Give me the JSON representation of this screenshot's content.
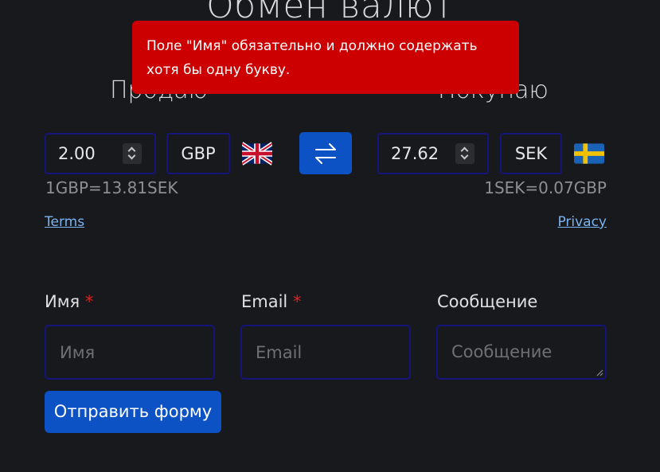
{
  "page": {
    "title": "Обмен валют"
  },
  "toast": {
    "message": "Поле \"Имя\" обязательно и должно содержать хотя бы одну букву.",
    "color": "#cc0000"
  },
  "sell": {
    "heading": "Продаю",
    "amount": "2.00",
    "currency": "GBP",
    "flag_icon": "uk-flag-icon",
    "rate": "1GBP=13.81SEK"
  },
  "buy": {
    "heading": "Покупаю",
    "amount": "27.62",
    "currency": "SEK",
    "flag_icon": "sweden-flag-icon",
    "rate": "1SEK=0.07GBP"
  },
  "swap": {
    "icon": "swap-arrows-icon",
    "color": "#0d52c4"
  },
  "links": {
    "terms": "Terms",
    "privacy": "Privacy"
  },
  "form": {
    "name_label": "Имя",
    "name_placeholder": "Имя",
    "email_label": "Email",
    "email_placeholder": "Email",
    "message_label": "Сообщение",
    "message_placeholder": "Сообщение",
    "required_mark": "*",
    "submit_label": "Отправить форму"
  }
}
